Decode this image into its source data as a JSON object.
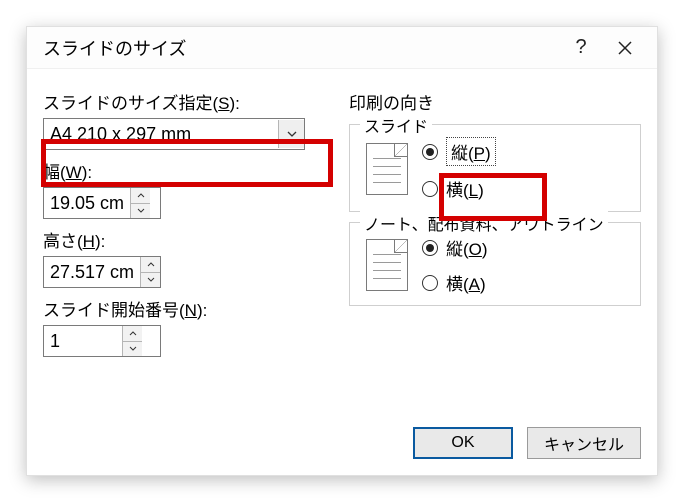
{
  "dialog": {
    "title": "スライドのサイズ",
    "help_symbol": "?"
  },
  "left": {
    "size_label": "スライドのサイズ指定(",
    "size_accel": "S",
    "size_label_after": "):",
    "size_value": "A4 210 x 297 mm",
    "width_label": "幅(",
    "width_accel": "W",
    "width_label_after": "):",
    "width_value": "19.05 cm",
    "height_label": "高さ(",
    "height_accel": "H",
    "height_label_after": "):",
    "height_value": "27.517 cm",
    "start_label": "スライド開始番号(",
    "start_accel": "N",
    "start_label_after": "):",
    "start_value": "1"
  },
  "right": {
    "orientation_label": "印刷の向き",
    "slide_legend": "スライド",
    "slide_portrait_label": "縦(",
    "slide_portrait_accel": "P",
    "slide_portrait_after": ")",
    "slide_landscape_label": "横(",
    "slide_landscape_accel": "L",
    "slide_landscape_after": ")",
    "notes_legend": "ノート、配布資料、アウトライン",
    "notes_portrait_label": "縦(",
    "notes_portrait_accel": "O",
    "notes_portrait_after": ")",
    "notes_landscape_label": "横(",
    "notes_landscape_accel": "A",
    "notes_landscape_after": ")"
  },
  "buttons": {
    "ok": "OK",
    "cancel": "キャンセル"
  }
}
